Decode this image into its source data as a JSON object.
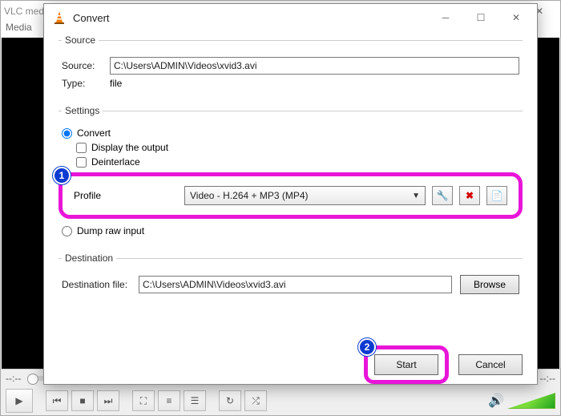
{
  "main": {
    "title": "VLC media player",
    "menu": "Media",
    "time_left": "--:--",
    "time_right": "--:--"
  },
  "dialog": {
    "title": "Convert",
    "source_legend": "Source",
    "source_label": "Source:",
    "source_value": "C:\\Users\\ADMIN\\Videos\\xvid3.avi",
    "type_label": "Type:",
    "type_value": "file",
    "settings_legend": "Settings",
    "radio_convert": "Convert",
    "cb_display": "Display the output",
    "cb_deinterlace": "Deinterlace",
    "profile_label": "Profile",
    "profile_value": "Video - H.264 + MP3 (MP4)",
    "radio_dump": "Dump raw input",
    "dest_legend": "Destination",
    "dest_label": "Destination file:",
    "dest_value": "C:\\Users\\ADMIN\\Videos\\xvid3.avi",
    "browse": "Browse",
    "start": "Start",
    "cancel": "Cancel"
  },
  "annotations": {
    "step1": "1",
    "step2": "2"
  }
}
